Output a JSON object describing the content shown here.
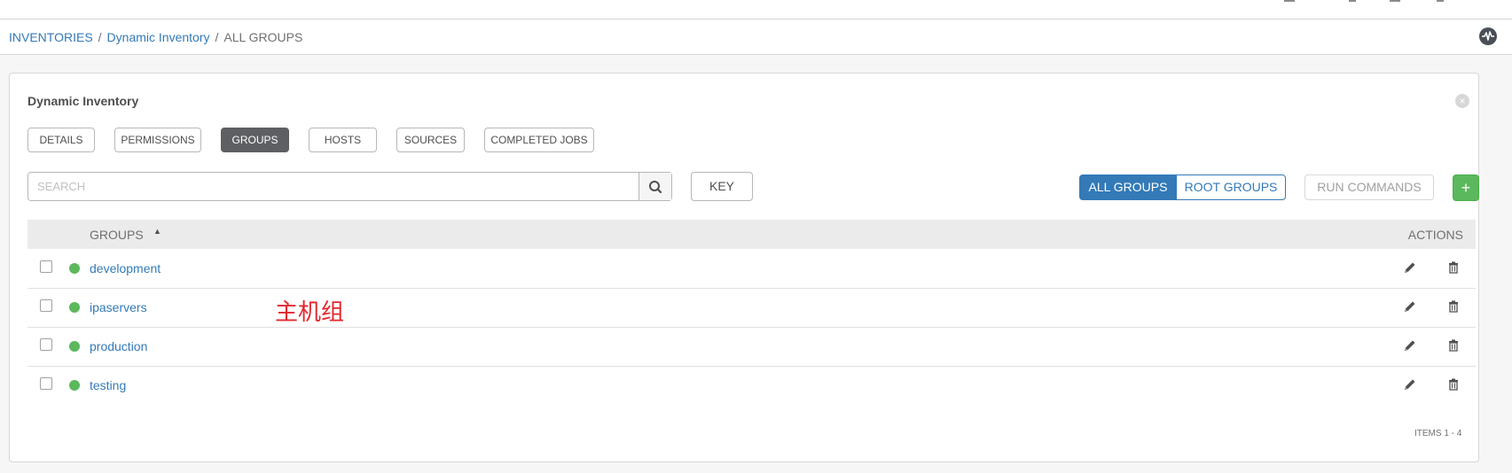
{
  "breadcrumb": {
    "inventories": "INVENTORIES",
    "sep1": "/",
    "inventory": "Dynamic Inventory",
    "sep2": "/",
    "current": "ALL GROUPS"
  },
  "panel": {
    "title": "Dynamic Inventory",
    "close_icon": "close-icon"
  },
  "tabs": [
    {
      "label": "DETAILS",
      "active": false
    },
    {
      "label": "PERMISSIONS",
      "active": false
    },
    {
      "label": "GROUPS",
      "active": true
    },
    {
      "label": "HOSTS",
      "active": false
    },
    {
      "label": "SOURCES",
      "active": false
    },
    {
      "label": "COMPLETED JOBS",
      "active": false
    }
  ],
  "search": {
    "placeholder": "SEARCH",
    "value": ""
  },
  "toolbar": {
    "key_label": "KEY",
    "all_groups_label": "ALL GROUPS",
    "root_groups_label": "ROOT GROUPS",
    "run_commands_label": "RUN COMMANDS",
    "add_label": "+"
  },
  "table": {
    "col_groups": "GROUPS",
    "sort_indicator": "▲",
    "col_actions": "ACTIONS",
    "rows": [
      {
        "name": "development",
        "status": "success"
      },
      {
        "name": "ipaservers",
        "status": "success"
      },
      {
        "name": "production",
        "status": "success"
      },
      {
        "name": "testing",
        "status": "success"
      }
    ]
  },
  "annotation": "主机组",
  "pagination": {
    "items_label": "ITEMS  1 - 4"
  },
  "colors": {
    "link": "#337ab7",
    "status_success": "#5cb85c",
    "active_tab": "#5e5f63",
    "annotation": "#e3262d"
  }
}
